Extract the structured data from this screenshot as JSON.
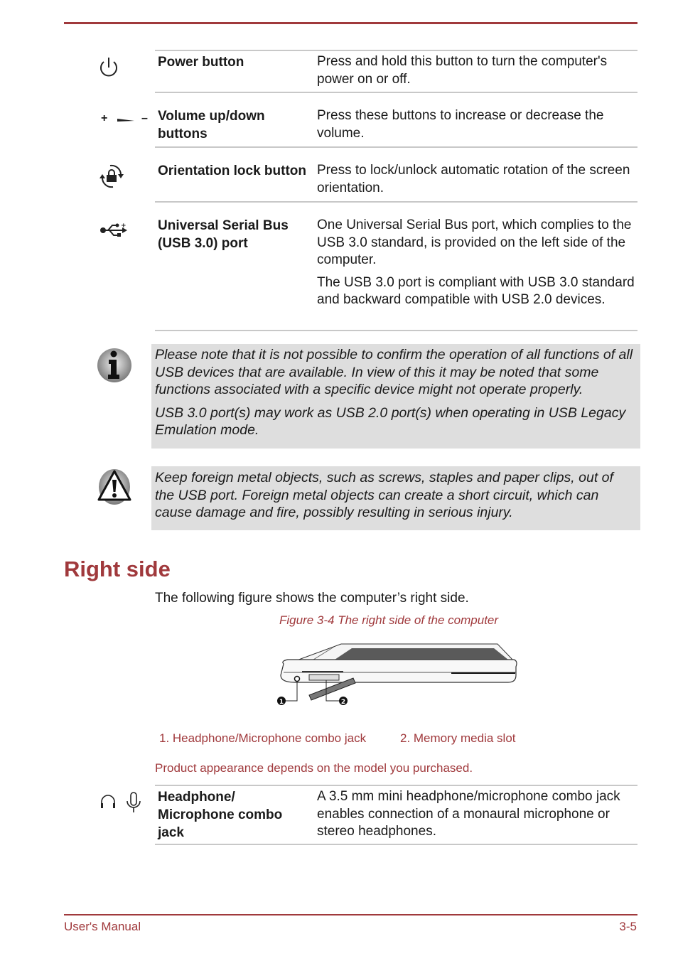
{
  "colors": {
    "accent": "#a0393c",
    "note_bg": "#dedede",
    "rule": "#c8c8c8"
  },
  "rows": [
    {
      "icon": "power-icon",
      "term": "Power button",
      "desc": [
        "Press and hold this button to turn the computer's power on or off."
      ]
    },
    {
      "icon": "volume-up-down-icon",
      "icon_text": {
        "plus": "+",
        "minus": "–"
      },
      "term": "Volume up/down buttons",
      "desc": [
        "Press these buttons to increase or decrease the volume."
      ]
    },
    {
      "icon": "orientation-lock-icon",
      "term": "Orientation lock button",
      "desc": [
        "Press to lock/unlock automatic rotation of the screen orientation."
      ]
    },
    {
      "icon": "usb-icon",
      "term": "Universal Serial Bus (USB 3.0) port",
      "desc": [
        "One Universal Serial Bus port, which complies to the USB 3.0 standard, is provided on the left side of the computer.",
        "The USB 3.0 port is compliant with USB 3.0 standard and backward compatible with USB 2.0 devices."
      ]
    }
  ],
  "info_note": {
    "icon": "info-icon",
    "paragraphs": [
      "Please note that it is not possible to confirm the operation of all functions of all USB devices that are available. In view of this it may be noted that some functions associated with a specific device might not operate properly.",
      "USB 3.0 port(s) may work as USB 2.0 port(s) when operating in USB Legacy Emulation mode."
    ]
  },
  "warning_note": {
    "icon": "warning-icon",
    "paragraphs": [
      "Keep foreign metal objects, such as screws, staples and paper clips, out of the USB port. Foreign metal objects can create a short circuit, which can cause damage and fire, possibly resulting in serious injury."
    ]
  },
  "section": {
    "title": "Right side",
    "intro": "The following figure shows the computer’s right side.",
    "figure_caption": "Figure 3-4 The right side of the computer",
    "figure_callouts": [
      "1",
      "2"
    ],
    "legend": [
      "1. Headphone/Microphone combo jack",
      "2. Memory media slot"
    ],
    "appearance_note": "Product appearance depends on the model you purchased."
  },
  "jack_row": {
    "icon": "headphone-microphone-icon",
    "term": "Headphone/ Microphone combo jack",
    "desc": [
      "A 3.5 mm mini headphone/microphone combo jack enables connection of a monaural microphone or stereo headphones."
    ]
  },
  "footer": {
    "left": "User's Manual",
    "right": "3-5"
  }
}
